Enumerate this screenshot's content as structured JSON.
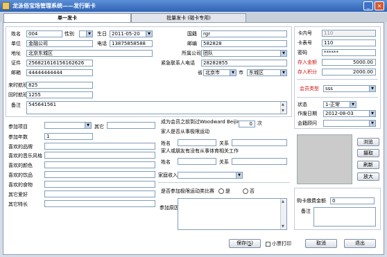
{
  "window": {
    "title": "龙泳俗宝场管理系统——发行新卡",
    "min": "_",
    "close": "×"
  },
  "tabs": [
    {
      "label": "单一发卡"
    },
    {
      "label": "批量发卡 (磁卡专用)"
    }
  ],
  "form": {
    "name_label": "姓名",
    "name": "004",
    "gender_label": "性别",
    "gender": "",
    "birthday_label": "生日",
    "birthday": "2011-05-20",
    "nationality_label": "国籍",
    "nationality": "rgr",
    "unit_label": "单位",
    "unit": "金融公司",
    "phone_label": "电话",
    "phone": "13875858588",
    "postcode_label": "邮编",
    "postcode": "582828",
    "address_label": "地址",
    "address": "北京东城区",
    "company_label": "所属公司",
    "company": "团队",
    "id_label": "证件",
    "id": "256821616156162626",
    "emergency_label": "紧急联系人电话",
    "emergency": "28282855",
    "email_label": "邮箱",
    "email": "44444444444",
    "province_label": "省",
    "province": "北京市",
    "city_label": "市",
    "city": "东城区",
    "arrive_flight_label": "来时航班",
    "arrive_flight": "825",
    "return_flight_label": "回时航班",
    "return_flight": "1255",
    "remark_label": "备注",
    "remark": "545641561"
  },
  "card": {
    "inner_no_label": "卡内号",
    "inner_no": "110",
    "surface_no_label": "卡表号",
    "surface_no": "110",
    "password_label": "密码",
    "password": "******",
    "deposit_label": "存入金额",
    "deposit": "5000.00",
    "points_label": "存入积分",
    "points": "2000.00",
    "member_type_label": "会员类型",
    "member_type": "sss",
    "status_label": "状态",
    "status": "1-正常",
    "date_label": "作废日期",
    "date": "2012-08-03",
    "advisor_label": "会籍顾问",
    "advisor": ""
  },
  "prefs": {
    "project_label": "参加项目",
    "other_label": "其它",
    "years_label": "参加年数",
    "years": "1",
    "brand_label": "喜欢的品牌",
    "music_label": "喜欢的音乐风格",
    "color_label": "喜欢的颜色",
    "drink_label": "喜欢的饮品",
    "food_label": "喜欢的食物",
    "hobby_label": "其它爱好",
    "skill_label": "其它特长"
  },
  "family": {
    "member_text": "成为会员之前到过Woodward Beijing",
    "times": "0",
    "times_unit": "次",
    "sports_q": "家人是否从事极限运动",
    "name_label": "姓名",
    "relation_label": "关系",
    "friends_q": "家人或朋友有没有从事体育相关工作",
    "income_label": "家庭收入",
    "compete_q": "是否参加极限运动类比赛",
    "yes": "是",
    "no": "否",
    "reason_label": "参加原因"
  },
  "side": {
    "browse": "浏览",
    "capture": "摄取",
    "refresh": "刷新",
    "enlarge": "放大",
    "fee_label": "购卡缴费金额",
    "fee": "0",
    "remark_label": "备注"
  },
  "bottom": {
    "save": "保存",
    "save_key": "S",
    "print_label": "小票打印",
    "cancel": "取消",
    "exit": "退出"
  }
}
